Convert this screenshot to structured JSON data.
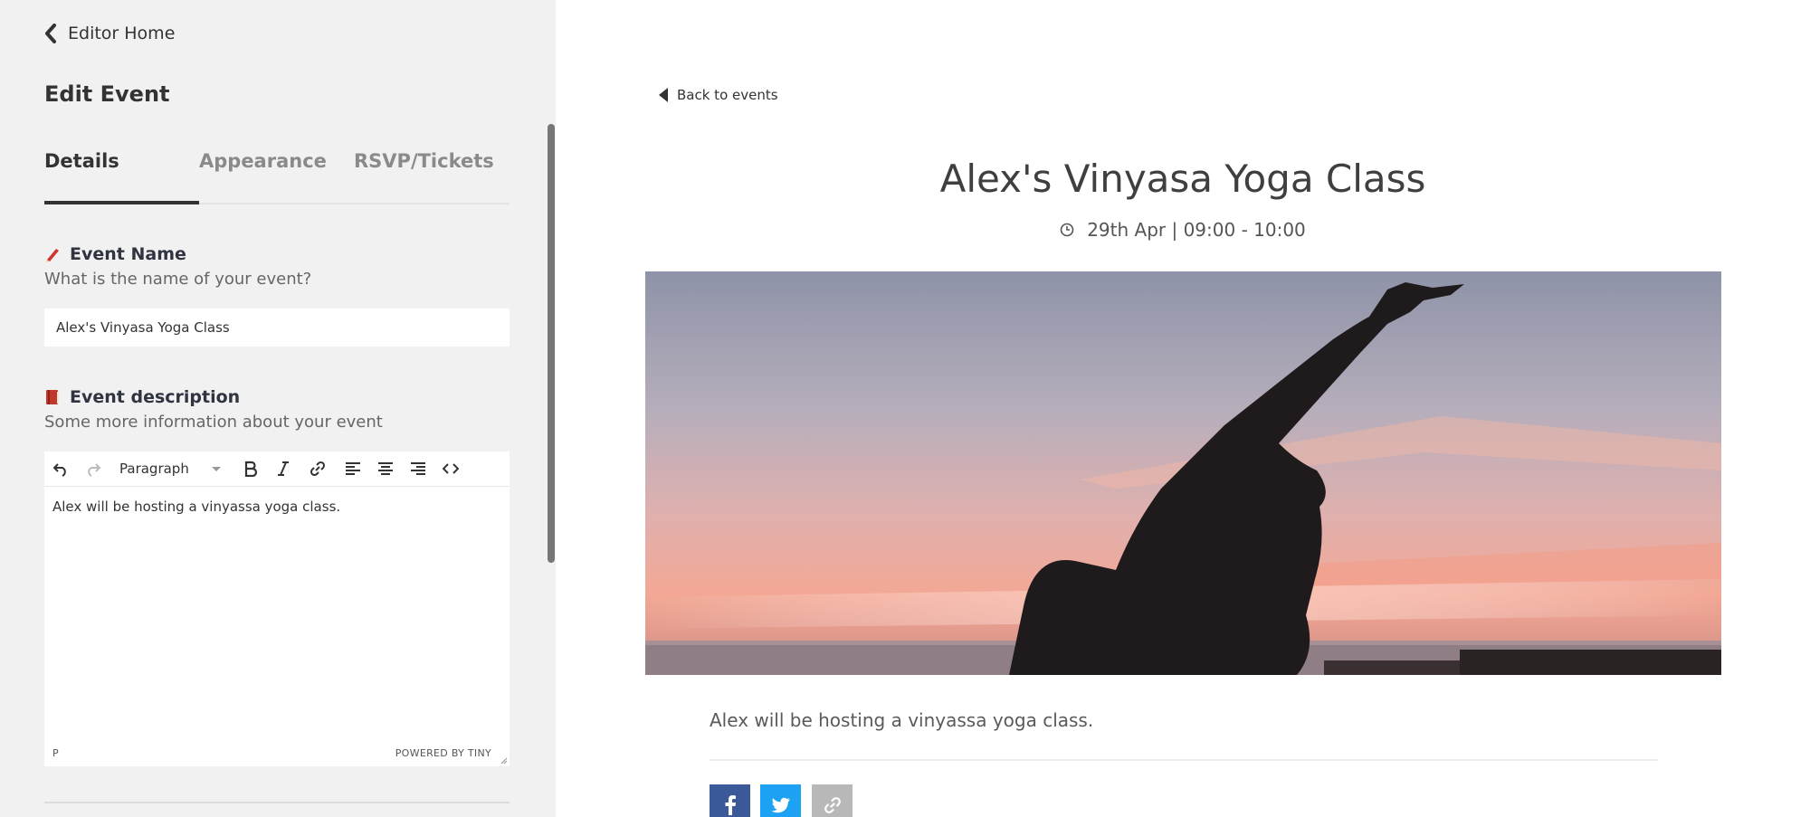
{
  "sidebar": {
    "back_label": "Editor Home",
    "title": "Edit Event",
    "tabs": [
      {
        "label": "Details"
      },
      {
        "label": "Appearance"
      },
      {
        "label": "RSVP/Tickets"
      }
    ],
    "event_name": {
      "label": "Event Name",
      "help": "What is the name of your event?",
      "value": "Alex's Vinyasa Yoga Class"
    },
    "event_description": {
      "label": "Event description",
      "help": "Some more information about your event",
      "format": "Paragraph",
      "body": "Alex will be hosting a vinyassa yoga class.",
      "status_path": "P",
      "powered_by": "POWERED BY TINY"
    }
  },
  "preview": {
    "back_label": "Back to events",
    "title": "Alex's Vinyasa Yoga Class",
    "datetime": "29th Apr | 09:00 - 10:00",
    "description": "Alex will be hosting a vinyassa yoga class."
  },
  "colors": {
    "sidebar_bg": "#f1f1f1",
    "facebook": "#3b5998",
    "twitter": "#1da1f2",
    "link_share": "#b8b8b8"
  }
}
